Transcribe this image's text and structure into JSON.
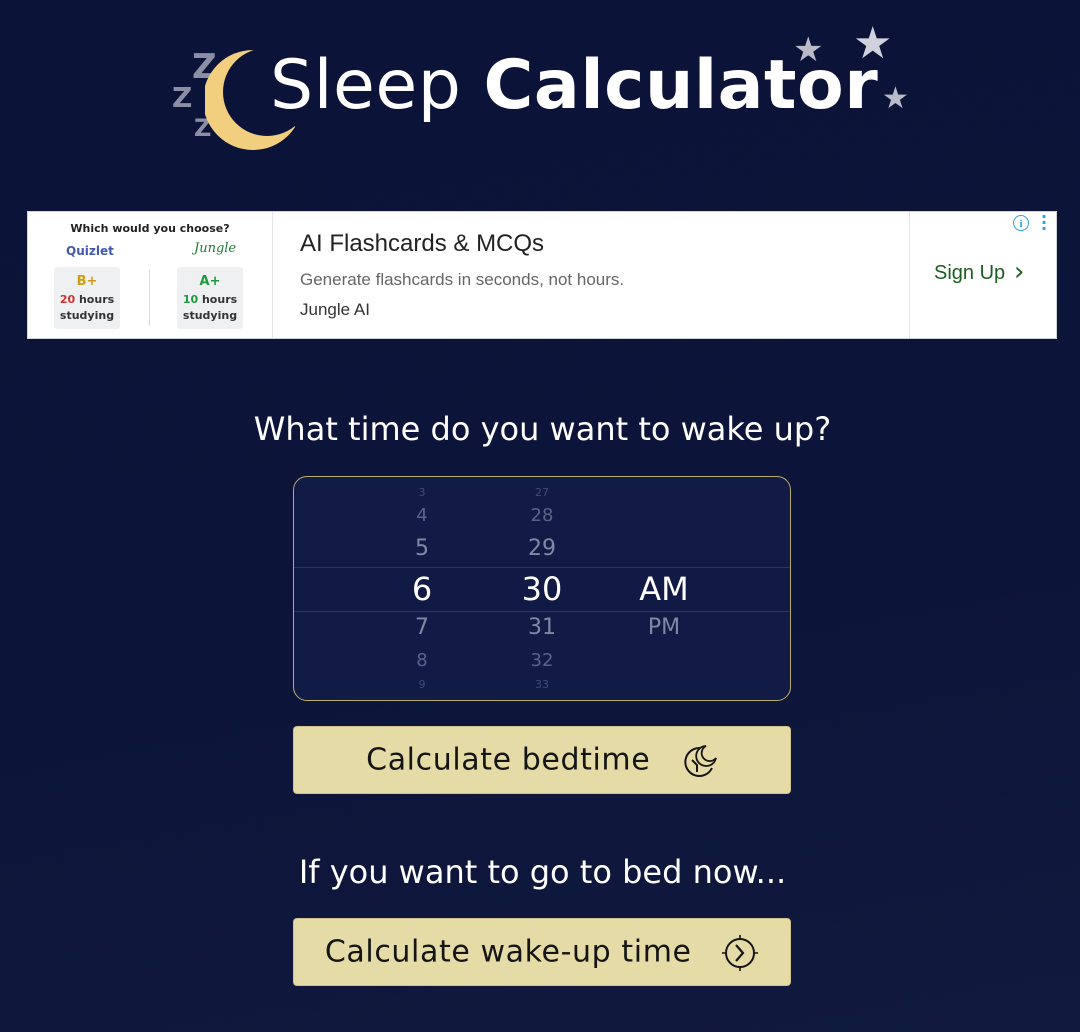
{
  "header": {
    "zzz": [
      "Z",
      "Z",
      "Z"
    ],
    "title_light": "Sleep",
    "title_bold": "Calculator",
    "star_glyph": "★"
  },
  "ad": {
    "question": "Which would you choose?",
    "brand_left": "Quizlet",
    "brand_right": "Jungle",
    "left_grade": "B+",
    "left_hours_num": "20",
    "left_hours_label": "hours",
    "left_studying": "studying",
    "right_grade": "A+",
    "right_hours_num": "10",
    "right_hours_label": "hours",
    "right_studying": "studying",
    "headline": "AI Flashcards & MCQs",
    "description": "Generate flashcards in seconds, not hours.",
    "advertiser": "Jungle AI",
    "cta": "Sign Up",
    "cta_chevron": "›",
    "info": "i",
    "colors": {
      "cta": "#1a5e20",
      "info": "#2aa1e0"
    }
  },
  "wake_question": "What time do you want to wake up?",
  "picker": {
    "hours": {
      "far_above": "3",
      "mid_above": "4",
      "near_above": "5",
      "selected": "6",
      "near_below": "7",
      "mid_below": "8",
      "far_below": "9"
    },
    "minutes": {
      "far_above": "27",
      "mid_above": "28",
      "near_above": "29",
      "selected": "30",
      "near_below": "31",
      "mid_below": "32",
      "far_below": "33"
    },
    "period": {
      "selected": "AM",
      "near_below": "PM"
    }
  },
  "buttons": {
    "bedtime": {
      "label": "Calculate bedtime",
      "icon": "sleep-moon-icon"
    },
    "wakeup": {
      "label": "Calculate wake-up time",
      "icon": "wake-sun-icon"
    }
  },
  "bed_now_question": "If you want to go to bed now...",
  "colors": {
    "background": "#0b1338",
    "button": "#e5dba6",
    "moon": "#f2cf7e",
    "picker_border": "#b8ae6a"
  }
}
